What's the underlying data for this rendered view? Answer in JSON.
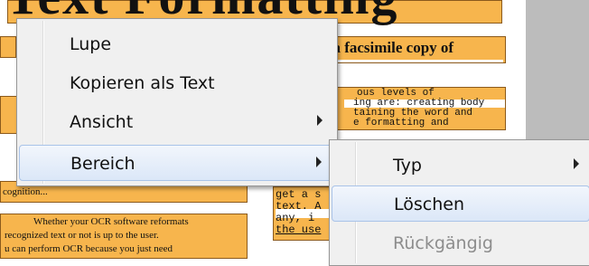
{
  "document": {
    "heading_text": "Text Formatting",
    "box_facsimile": "te a facsimile copy of",
    "box_mono_lines": [
      "ous levels of",
      "ing are: creating body",
      "taining the word and",
      "e formatting and"
    ],
    "box_recognition": "cognition...",
    "box_lower_lines": [
      "Whether your OCR software reformats",
      "recognized text or not is up to the user.",
      "u can perform OCR because you just need"
    ],
    "box_mono2_lines": [
      "get a s",
      "text. A",
      "any, i",
      "the use"
    ]
  },
  "context_menu": {
    "items": [
      {
        "label": "Lupe",
        "has_submenu": false,
        "state": "normal"
      },
      {
        "label": "Kopieren als Text",
        "has_submenu": false,
        "state": "normal"
      },
      {
        "label": "Ansicht",
        "has_submenu": true,
        "state": "normal"
      },
      {
        "label": "Bereich",
        "has_submenu": true,
        "state": "hover"
      }
    ]
  },
  "submenu": {
    "items": [
      {
        "label": "Typ",
        "has_submenu": true,
        "state": "normal"
      },
      {
        "label": "Löschen",
        "has_submenu": false,
        "state": "hover"
      },
      {
        "label": "Rückgängig",
        "has_submenu": false,
        "state": "disabled"
      }
    ]
  },
  "colors": {
    "ocr_region": "#f7b54d",
    "menu_background": "#f0f0f0",
    "hover_highlight": "#dbe7f8",
    "disabled_text": "#8d8d8d"
  }
}
